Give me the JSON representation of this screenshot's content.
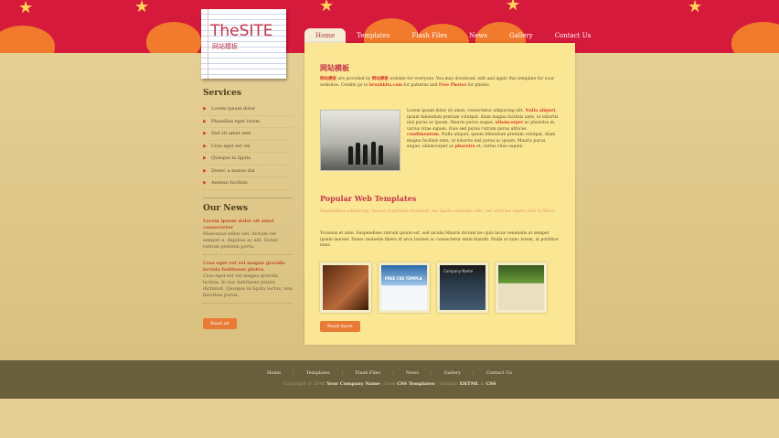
{
  "logo": {
    "title": "TheSITE",
    "subtitle": "网站模板"
  },
  "nav": [
    "Home",
    "Templates",
    "Flash Files",
    "News",
    "Gallery",
    "Contact Us"
  ],
  "services": {
    "heading": "Services",
    "items": [
      "Lorem ipsum dolor",
      "Phasellus eget lorem",
      "Sed sit amet sem",
      "Cras eget est vel",
      "Quisque in ligula",
      "Donec a massa dui",
      "Aenean facilisis"
    ]
  },
  "news": {
    "heading": "Our News",
    "items": [
      {
        "title": "Lorem ipsum dolor sit amet consectetur",
        "text": "Maecenas tellus est, dictum vel semper a, dapibus ac elit. Donec rutrum pretium porta."
      },
      {
        "title": "Cras eget est vel magna gravida lacinia habitasse platea",
        "text": "Cras eget est vel magna gravida lacinia. In hac habitasse platea dictumst. Quisque in ligula lectus, non faucibus purus."
      }
    ],
    "read_all": "Read all"
  },
  "main": {
    "heading": "网站模板",
    "intro": {
      "hl1": "网站模板",
      "t1": " are provided by ",
      "hl2": "网站模板",
      "t2": " website for everyone. You may download, edit and apply this template for your websites. Credits go to ",
      "hl3": "brushkits.com",
      "t3": " for patterns and ",
      "hl4": "Free Photos",
      "t4": " for photos."
    },
    "body": {
      "t1": "Lorem ipsum dolor sit amet, consectetur adipiscing elit. ",
      "hl1": "Nulla aliquet",
      "t2": ", ipsum bibendum pretium volutpat, diam magna facilisis ante, ut lobortis nisl purus ac ipsum. Mauris purus augue, ",
      "hl2": "ullamcorper",
      "t3": " ac pharetra et, varius vitae sapien. Duis sed purus rutrum purus ultrices ",
      "hl3": "condimentum",
      "t4": ". Nulla aliquet, ipsum bibendum pretium volutpat, diam magna facilisis ante, ut lobortis nisl purus ac ipsum. Mauris purus augue, ullamcorper ac ",
      "hl4": "pharetra",
      "t5": " et, varius vitae sapien."
    },
    "popular": {
      "heading": "Popular Web Templates",
      "italic": "Suspendisse adipiscing, mauris et pretium tincidunt, dui ligula venenatis odio, nec ultricies sapien felis in libero.",
      "text": "Vivamus et ante. Suspendisse rutrum ipsum est, sed iaculis.Mauris dictum leo quis lacus venenatis at semper ipsum laoreet. Donec molestie libero id arcu laoreet ac consectetur enim blandit. Nulla at nunc lorem, at porttitor nunc.",
      "thumb2_label": "FREE CSS TEMPLA",
      "thumb3_label": "Company Name",
      "read_more": "Read more"
    }
  },
  "footer": {
    "nav": [
      "Home",
      "Templates",
      "Flash Files",
      "News",
      "Gallery",
      "Contact Us"
    ],
    "copy_pre": "Copyright © 2048 ",
    "company": "Your Company Name",
    "mid": " | from ",
    "css_templates": "CSS Templates",
    "valid": " | Validate ",
    "xhtml": "XHTML",
    "and": " & ",
    "css": "CSS"
  }
}
